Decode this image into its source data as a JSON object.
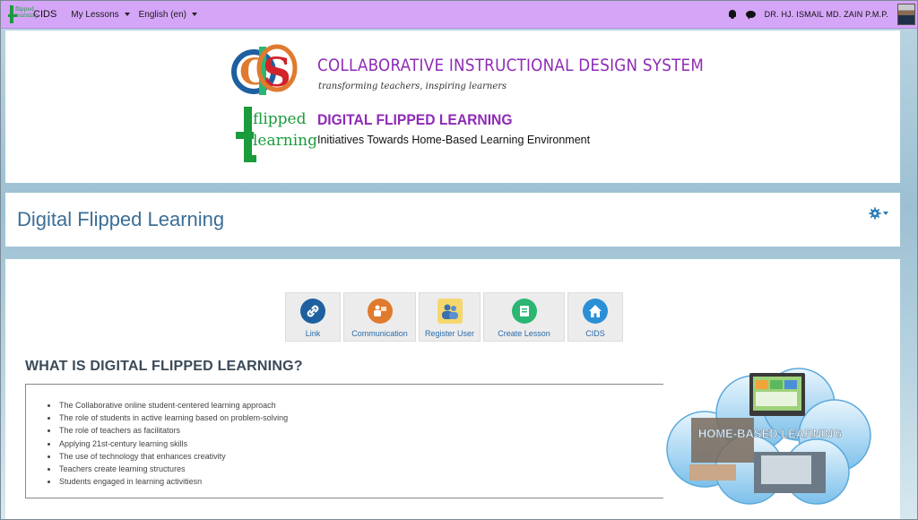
{
  "navbar": {
    "brand": "CIDS",
    "logo_text": "flipped learning",
    "menu_lessons": "My Lessons",
    "menu_language": "English (en)",
    "username": "DR. HJ. ISMAIL MD. ZAIN P.M.P."
  },
  "banner": {
    "cids_logo_letters": "CIDS",
    "title": "COLLABORATIVE INSTRUCTIONAL DESIGN SYSTEM",
    "tagline": "transforming teachers, inspiring learners",
    "flip_logo_line1": "flipped",
    "flip_logo_line2": "learning",
    "subtitle": "DIGITAL FLIPPED LEARNING",
    "subtitle_desc": "Initiatives Towards Home-Based Learning Environment"
  },
  "page_header": {
    "title": "Digital Flipped Learning",
    "settings_icon": "gear-icon"
  },
  "tiles": [
    {
      "label": "Link",
      "icon": "link-icon",
      "color": "#1e5fa0"
    },
    {
      "label": "Communication",
      "icon": "presenter-icon",
      "color": "#e07a2e"
    },
    {
      "label": "Register User",
      "icon": "users-icon",
      "color": "#f5d76e"
    },
    {
      "label": "Create Lesson",
      "icon": "lesson-icon",
      "color": "#2bb673"
    },
    {
      "label": "CIDS",
      "icon": "home-icon",
      "color": "#2b8fd6"
    }
  ],
  "section": {
    "title": "WHAT IS DIGITAL FLIPPED LEARNING?",
    "items": [
      "The Collaborative online student-centered learning approach",
      "The role of students in active learning based on problem-solving",
      "The role of teachers as facilitators",
      "Applying 21st-century learning skills",
      "The use of technology that enhances creativity",
      "Teachers create learning structures",
      "Students engaged in learning activitiesn"
    ]
  },
  "cloud_image": {
    "caption": "HOME-BASED LEARNING"
  },
  "colors": {
    "navbar": "#d5a6f7",
    "title_purple": "#8e2bb5",
    "page_title_blue": "#3b6e96",
    "link_blue": "#2a6aa8"
  }
}
